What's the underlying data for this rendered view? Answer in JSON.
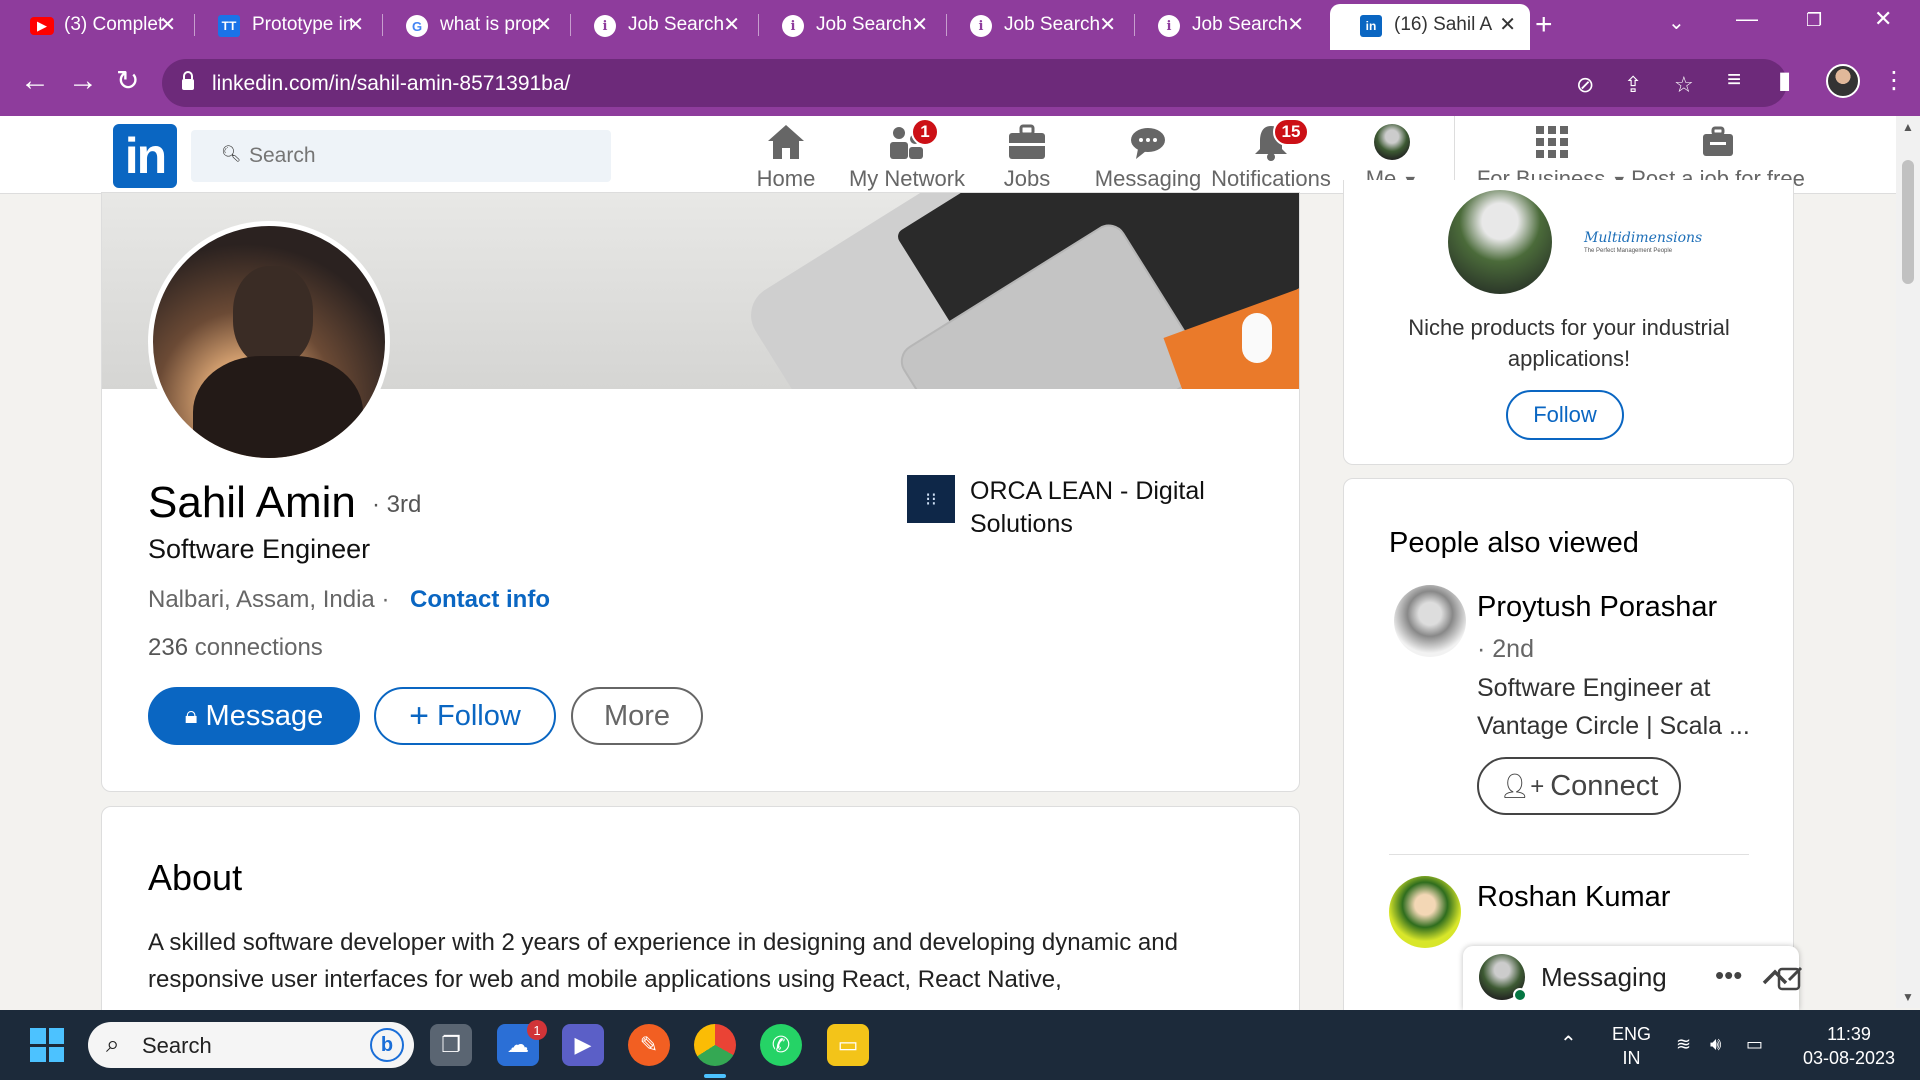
{
  "browser": {
    "tabs": [
      {
        "title": "(3) Complete",
        "favicon": "youtube-icon",
        "color": "#ff0000"
      },
      {
        "title": "Prototype in",
        "favicon": "tt-icon",
        "color": "#1a73e8"
      },
      {
        "title": "what is prop",
        "favicon": "google-icon",
        "color": "#ffffff"
      },
      {
        "title": "Job Search",
        "favicon": "info-icon",
        "color": "#ffffff"
      },
      {
        "title": "Job Search",
        "favicon": "info-icon",
        "color": "#ffffff"
      },
      {
        "title": "Job Search",
        "favicon": "info-icon",
        "color": "#ffffff"
      },
      {
        "title": "Job Search",
        "favicon": "info-icon",
        "color": "#ffffff"
      },
      {
        "title": "(16) Sahil A",
        "favicon": "linkedin-icon",
        "color": "#0a66c2"
      }
    ],
    "url": "linkedin.com/in/sahil-amin-8571391ba/",
    "theme_color": "#8e3c9c"
  },
  "linkedin_nav": {
    "logo": "in",
    "search_placeholder": "Search",
    "items": [
      {
        "label": "Home",
        "icon": "home-icon",
        "badge": ""
      },
      {
        "label": "My Network",
        "icon": "network-icon",
        "badge": "1"
      },
      {
        "label": "Jobs",
        "icon": "briefcase-icon",
        "badge": ""
      },
      {
        "label": "Messaging",
        "icon": "messaging-icon",
        "badge": ""
      },
      {
        "label": "Notifications",
        "icon": "bell-icon",
        "badge": "15"
      },
      {
        "label": "Me",
        "icon": "avatar-icon",
        "badge": ""
      },
      {
        "label": "For Business",
        "icon": "grid-icon",
        "badge": ""
      },
      {
        "label": "Post a job for free",
        "icon": "post-job-icon",
        "badge": ""
      }
    ]
  },
  "profile": {
    "name": "Sahil Amin",
    "degree": "· 3rd",
    "headline": "Software Engineer",
    "location": "Nalbari, Assam, India ·",
    "contact_info": "Contact info",
    "connections_count": "236",
    "connections_label": "connections",
    "company": "ORCA LEAN - Digital Solutions",
    "buttons": {
      "message": "Message",
      "follow": "Follow",
      "more": "More"
    }
  },
  "about": {
    "title": "About",
    "text": "A skilled software developer with 2 years of experience in designing and developing dynamic and responsive user interfaces for web and mobile applications using React, React Native,"
  },
  "ad": {
    "brand": "Multidimensions",
    "brand_sub": "The Perfect Management People",
    "text": "Niche products for your industrial applications!",
    "button": "Follow"
  },
  "people_also_viewed": {
    "title": "People also viewed",
    "people": [
      {
        "name": "Proytush Porashar",
        "degree": "· 2nd",
        "info": "Software Engineer at Vantage Circle | Scala ...",
        "button": "Connect"
      },
      {
        "name": "Roshan Kumar",
        "degree": "",
        "info": "",
        "button": ""
      }
    ]
  },
  "messaging": {
    "title": "Messaging"
  },
  "taskbar": {
    "search": "Search",
    "language": "ENG",
    "region": "IN",
    "time": "11:39",
    "date": "03-08-2023",
    "teams_badge": "1"
  }
}
